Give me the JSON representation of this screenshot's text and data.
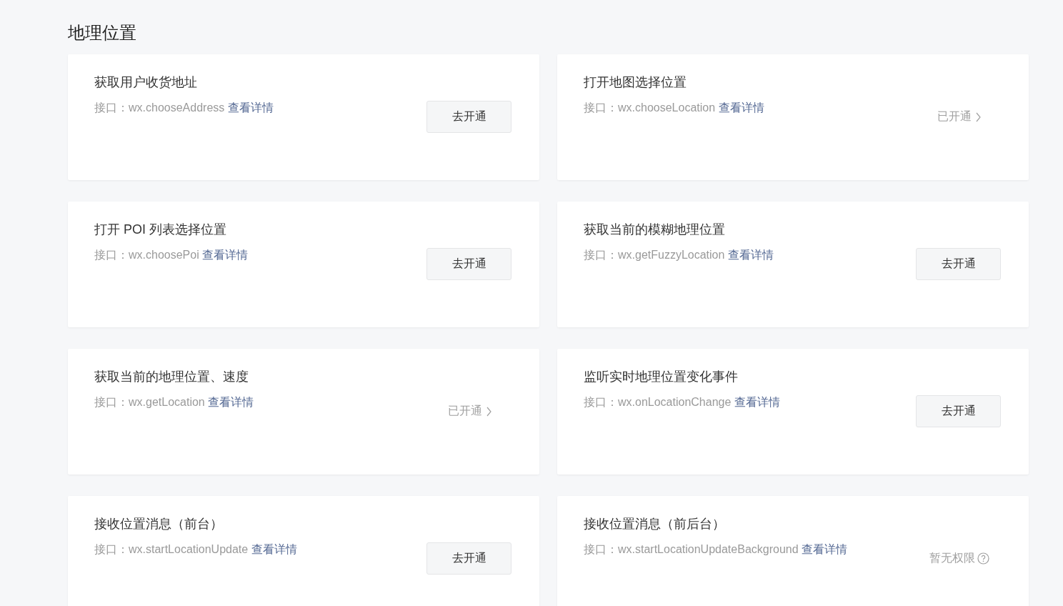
{
  "section_title": "地理位置",
  "cards": [
    {
      "title": "获取用户收货地址",
      "api_text": "接口：wx.chooseAddress",
      "link": "查看详情",
      "status": {
        "kind": "button",
        "label": "去开通"
      }
    },
    {
      "title": "打开地图选择位置",
      "api_text": "接口：wx.chooseLocation",
      "link": "查看详情",
      "status": {
        "kind": "enabled",
        "label": "已开通"
      }
    },
    {
      "title": "打开 POI 列表选择位置",
      "api_text": "接口：wx.choosePoi",
      "link": "查看详情",
      "status": {
        "kind": "button",
        "label": "去开通"
      }
    },
    {
      "title": "获取当前的模糊地理位置",
      "api_text": "接口：wx.getFuzzyLocation",
      "link": "查看详情",
      "status": {
        "kind": "button",
        "label": "去开通"
      }
    },
    {
      "title": "获取当前的地理位置、速度",
      "api_text": "接口：wx.getLocation",
      "link": "查看详情",
      "status": {
        "kind": "enabled",
        "label": "已开通"
      }
    },
    {
      "title": "监听实时地理位置变化事件",
      "api_text": "接口：wx.onLocationChange",
      "link": "查看详情",
      "status": {
        "kind": "button",
        "label": "去开通"
      }
    },
    {
      "title": "接收位置消息（前台）",
      "api_text": "接口：wx.startLocationUpdate",
      "link": "查看详情",
      "status": {
        "kind": "button",
        "label": "去开通"
      }
    },
    {
      "title": "接收位置消息（前后台）",
      "api_text": "接口：wx.startLocationUpdateBackground",
      "link": "查看详情",
      "status": {
        "kind": "no_permission",
        "label": "暂无权限"
      }
    }
  ]
}
